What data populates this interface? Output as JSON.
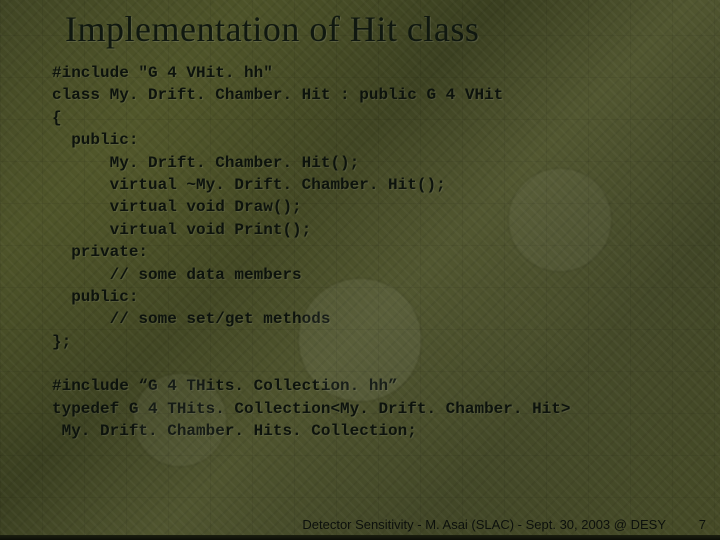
{
  "title": "Implementation of Hit class",
  "code_lines": [
    "#include \"G 4 VHit. hh\"",
    "class My. Drift. Chamber. Hit : public G 4 VHit",
    "{",
    "  public:",
    "      My. Drift. Chamber. Hit();",
    "      virtual ~My. Drift. Chamber. Hit();",
    "      virtual void Draw();",
    "      virtual void Print();",
    "  private:",
    "      // some data members",
    "  public:",
    "      // some set/get methods",
    "};",
    "",
    "#include “G 4 THits. Collection. hh”",
    "typedef G 4 THits. Collection<My. Drift. Chamber. Hit>",
    " My. Drift. Chamber. Hits. Collection;"
  ],
  "footer": "Detector Sensitivity - M. Asai (SLAC) - Sept. 30, 2003 @ DESY",
  "page_number": "7"
}
